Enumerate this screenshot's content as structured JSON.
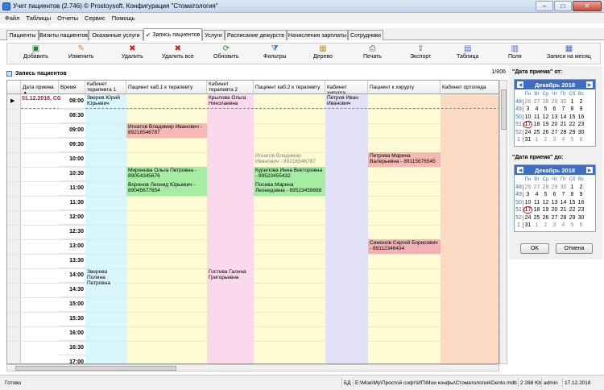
{
  "window": {
    "title": "Учет пациентов (2.746) © Prostoysoft. Конфигурация \"Стоматология\"",
    "min": "–",
    "max": "□",
    "close": "✕"
  },
  "menu": [
    "Файл",
    "Таблицы",
    "Отчеты",
    "Сервис",
    "Помощь"
  ],
  "tabs": [
    "Пациенты",
    "Визиты пациентов",
    "Оказанные услуги",
    "Запись пациентов",
    "Услуги",
    "Расписание дежурств",
    "Начисления зарплаты",
    "Сотрудники"
  ],
  "active_tab": "Запись пациентов",
  "toolbar": [
    {
      "label": "Добавить",
      "icon": "add-record-icon"
    },
    {
      "label": "Изменить",
      "icon": "pencil-icon"
    },
    {
      "label": "Удалить",
      "icon": "delete-x-icon"
    },
    {
      "label": "Удалить все",
      "icon": "delete-all-icon"
    },
    {
      "label": "Обновить",
      "icon": "refresh-icon"
    },
    {
      "label": "Фильтры",
      "icon": "filter-icon"
    },
    {
      "label": "Дерево",
      "icon": "tree-icon"
    },
    {
      "label": "Печать",
      "icon": "printer-icon"
    },
    {
      "label": "Экспорт",
      "icon": "export-icon"
    },
    {
      "label": "Таблица",
      "icon": "table-icon"
    },
    {
      "label": "Поля",
      "icon": "fields-icon"
    },
    {
      "label": "Записи на месяц",
      "icon": "calendar-month-icon"
    }
  ],
  "section": {
    "title": "Запись пациентов",
    "counter": "1/806"
  },
  "columns": [
    "Дата приема",
    "Время",
    "Кабинет терапевта 1",
    "Пациент каб.1 к терапевту",
    "Кабинет терапевта 2",
    "Пациент каб.2 к терапевту",
    "Кабинет хирурга",
    "Пациент к хирургу",
    "Кабинет ортопеда"
  ],
  "sort_indicator": "▲",
  "current_row_marker": "▶",
  "first_date": "01.12.2018, Сб",
  "times": [
    "08:00",
    "08:30",
    "09:00",
    "09:30",
    "10:00",
    "10:30",
    "11:00",
    "11:30",
    "12:00",
    "12:30",
    "13:00",
    "13:30",
    "14:00",
    "14:30",
    "15:00",
    "15:30",
    "16:00",
    "16:30",
    "17:00"
  ],
  "colors": {
    "therapist1": "#d9f6fc",
    "patient1": "#fdfbd3",
    "therapist2": "#fbd9ec",
    "patient2": "#fdfbd3",
    "surgeon": "#e2e1f7",
    "patient_surgeon": "#fdfbd3",
    "orthoped": "#fcd9c2",
    "appt_red": "#f6b8b3",
    "appt_green": "#a6eda3",
    "appt_pink": "#f1b2b6"
  },
  "appointments": {
    "doc1_0800": "Зверев Юрий Юрьевич",
    "doc2_0800": "Крылова Ольга Николаевна",
    "surgeon_0800": "Петров Иван Иванович",
    "p1_0900": "Игнатов Владимир Иванович - 89216546787",
    "p2_1000": "Игнатов Владимир Иванович - 89216546787",
    "ps_1000": "Петрова Марина Валерьевна - 89115676545",
    "p1_1030": "Миронова Ольга Петровна - 89054345676",
    "p2_1030": "Курилова Инна Викторовна - 89523455432",
    "p1_1100": "Воронов Леонид Юрьевич - 89045677654",
    "p2_1100": "Посева Марина Леонидовна - 89523459888",
    "ps_1300": "Симонов Сергей Борисович - 89112346434",
    "doc1_1400": "Зверева Полина Петровна",
    "doc2_1400": "Гостева Галина Григорьевна"
  },
  "date_from": {
    "label": "\"Дата приема\" от:",
    "month": "Декабрь 2018"
  },
  "date_to": {
    "label": "\"Дата приема\" до:",
    "month": "Декабрь 2018"
  },
  "weekdays": [
    "Пн",
    "Вт",
    "Ср",
    "Чт",
    "Пт",
    "Сб",
    "Вс"
  ],
  "calendar_rows": [
    {
      "wk": "48",
      "days": [
        "26",
        "27",
        "28",
        "29",
        "30",
        "1",
        "2"
      ]
    },
    {
      "wk": "49",
      "days": [
        "3",
        "4",
        "5",
        "6",
        "7",
        "8",
        "9"
      ]
    },
    {
      "wk": "50",
      "days": [
        "10",
        "11",
        "12",
        "13",
        "14",
        "15",
        "16"
      ]
    },
    {
      "wk": "51",
      "days": [
        "17",
        "18",
        "19",
        "20",
        "21",
        "22",
        "23"
      ]
    },
    {
      "wk": "52",
      "days": [
        "24",
        "25",
        "26",
        "27",
        "28",
        "29",
        "30"
      ]
    },
    {
      "wk": "1",
      "days": [
        "31",
        "1",
        "2",
        "3",
        "4",
        "5",
        "6"
      ]
    }
  ],
  "buttons": {
    "ok": "OK",
    "cancel": "Отмена"
  },
  "status": {
    "ready": "Готово",
    "db_label": "БД",
    "db_path": "E:\\Мое\\My\\Простой софт\\ИП\\Мои конфы\\Стоматология\\Dento.mdb",
    "size": "2 288 Kb",
    "user": "admin",
    "date": "17.12.2018"
  }
}
